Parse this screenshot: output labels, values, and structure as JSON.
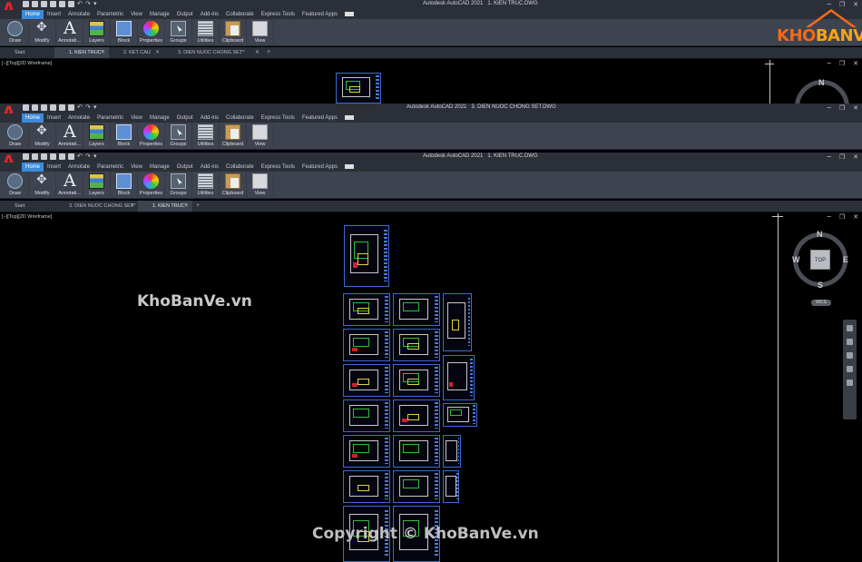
{
  "windows": [
    {
      "app_title": "Autodesk AutoCAD 2021",
      "doc_title": "1. KIEN TRUC.DWG",
      "menu": [
        "Home",
        "Insert",
        "Annotate",
        "Parametric",
        "View",
        "Manage",
        "Output",
        "Add-ins",
        "Collaborate",
        "Express Tools",
        "Featured Apps"
      ],
      "tabs": [
        "Start",
        "1. KIEN TRUC*",
        "2. KET CAU",
        "3. DIEN NUOC CHONG SET*"
      ],
      "viewport_label": "[−][Top][2D Wireframe]"
    },
    {
      "app_title": "Autodesk AutoCAD 2021",
      "doc_title": "3. DIEN NUOC CHONG SET.DWG",
      "menu": [
        "Home",
        "Insert",
        "Annotate",
        "Parametric",
        "View",
        "Manage",
        "Output",
        "Add-ins",
        "Collaborate",
        "Express Tools",
        "Featured Apps"
      ]
    },
    {
      "app_title": "Autodesk AutoCAD 2021",
      "doc_title": "1. KIEN TRUC.DWG",
      "menu": [
        "Home",
        "Insert",
        "Annotate",
        "Parametric",
        "View",
        "Manage",
        "Output",
        "Add-ins",
        "Collaborate",
        "Express Tools",
        "Featured Apps"
      ],
      "tabs": [
        "Start",
        "3. DIEN NUOC CHONG SET*",
        "1. KIEN TRUC*"
      ],
      "viewport_label": "[−][Top][2D Wireframe]"
    }
  ],
  "ribbon": [
    "Draw",
    "Modify",
    "Annotati...",
    "Layers",
    "Block",
    "Properties",
    "Groups",
    "Utilities",
    "Clipboard",
    "View"
  ],
  "viewcube": {
    "top": "TOP",
    "n": "N",
    "s": "S",
    "e": "E",
    "w": "W",
    "wcs": "WCS"
  },
  "watermarks": {
    "left": "KhoBanVe.vn",
    "bottom": "Copyright © KhoBanVe.vn"
  },
  "brand": {
    "k": "KHO",
    "b": "BANVE"
  }
}
